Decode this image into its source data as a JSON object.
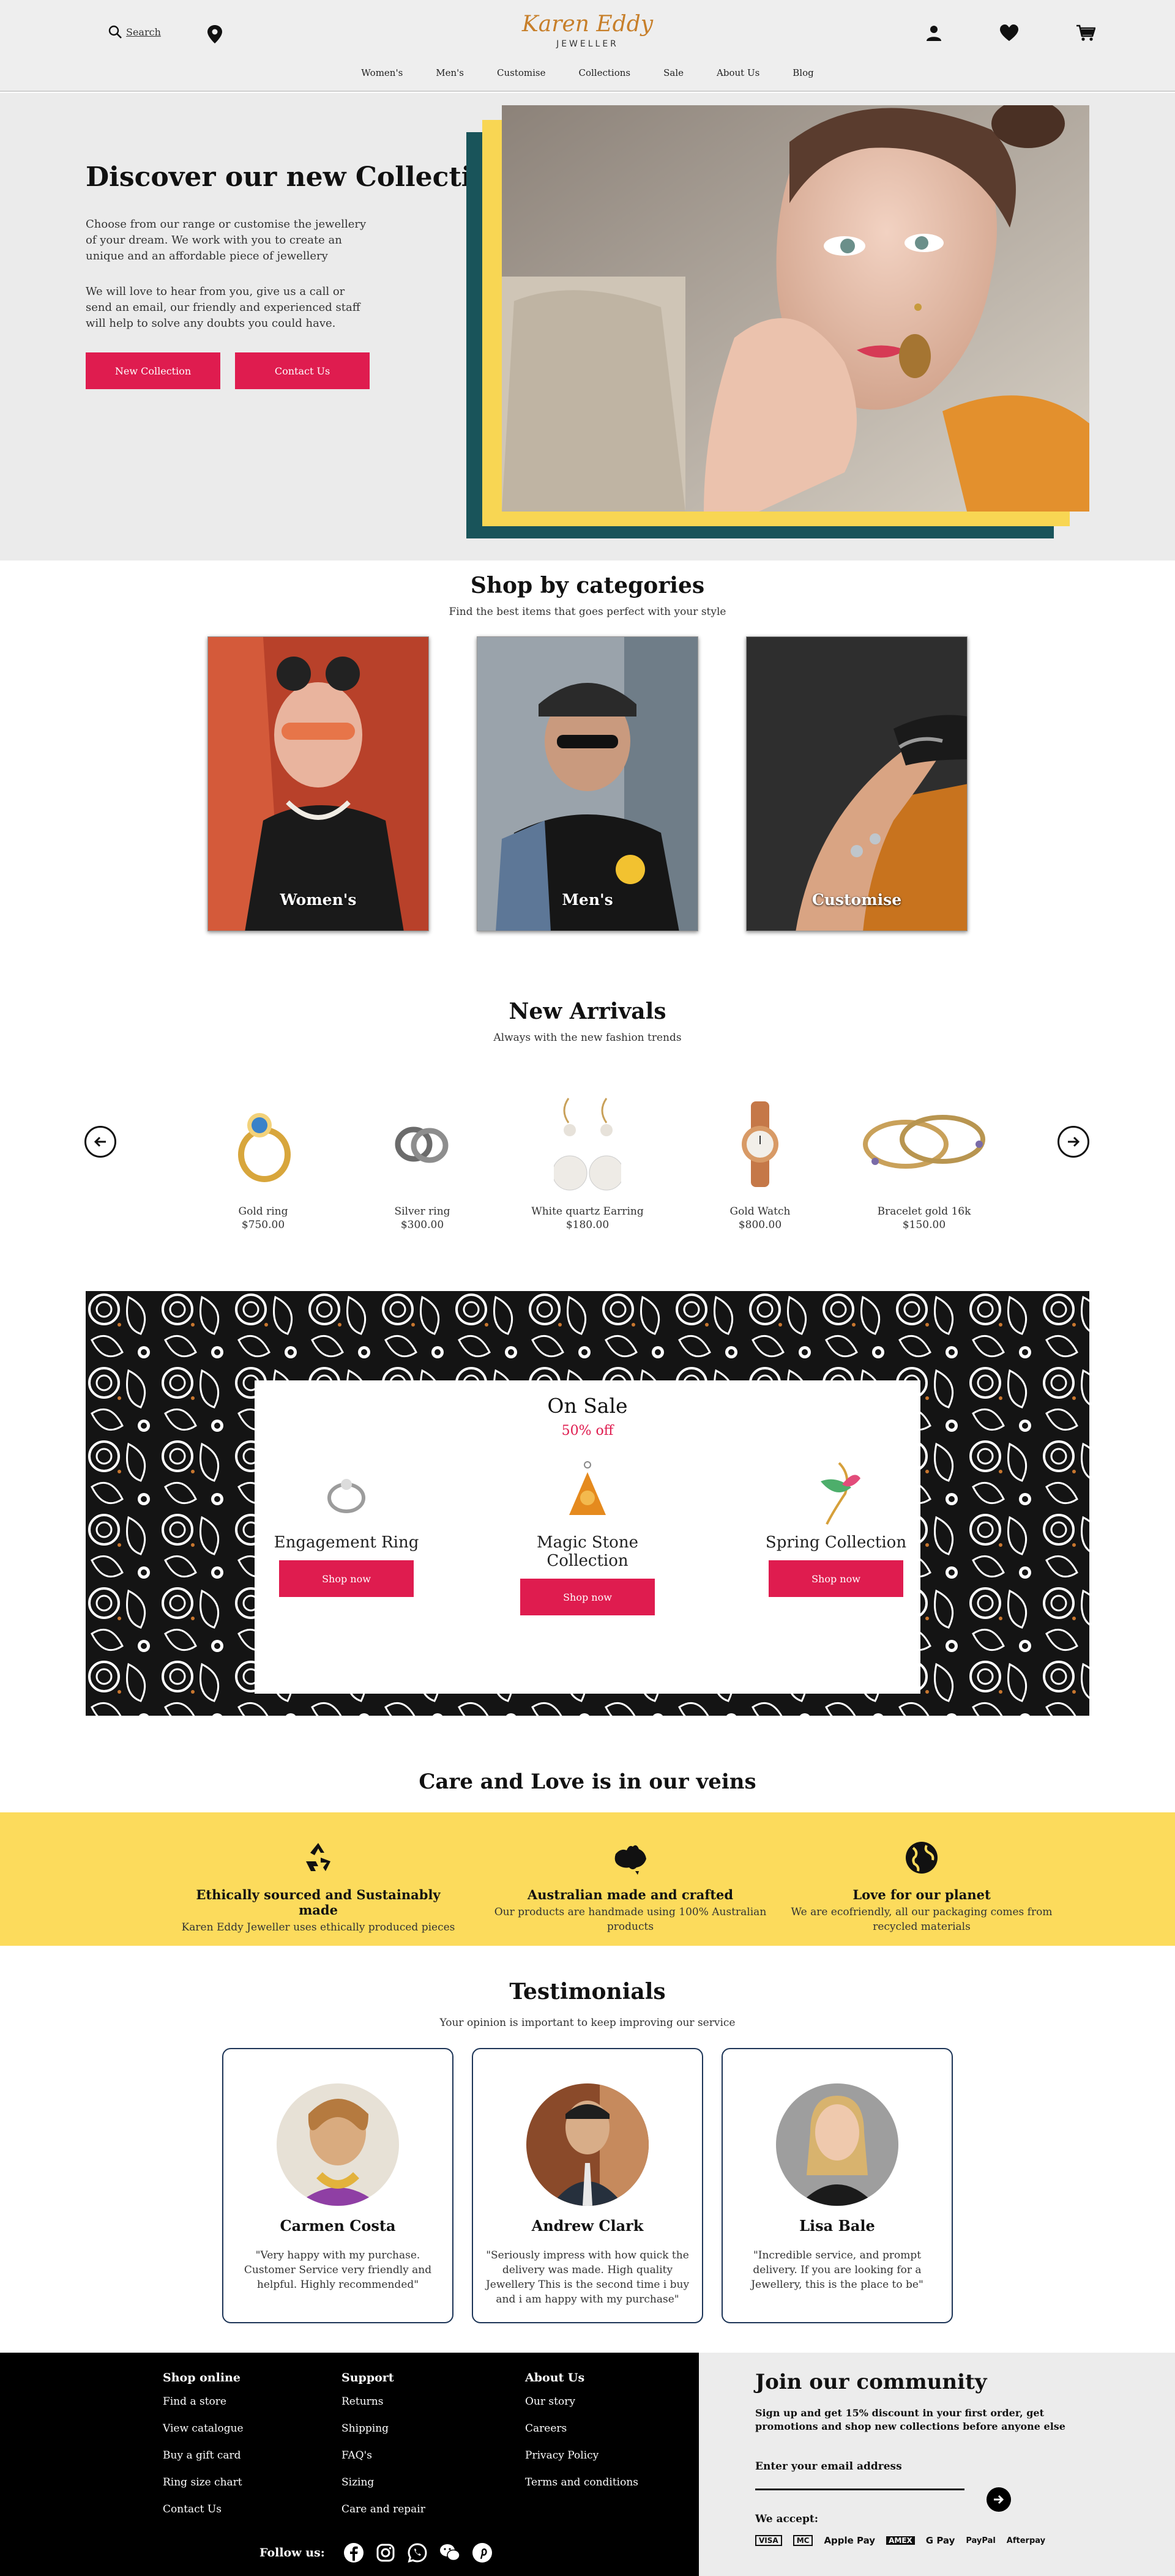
{
  "header": {
    "search_label": "Search",
    "brand": "Karen Eddy",
    "brand_sub": "JEWELLER",
    "nav": [
      "Women's",
      "Men's",
      "Customise",
      "Collections",
      "Sale",
      "About Us",
      "Blog"
    ]
  },
  "hero": {
    "title": "Discover our new Collection",
    "p1": "Choose from our range or customise the jewellery of your dream. We work with you to create an unique and an affordable piece of jewellery",
    "p2": "We will love to hear from you, give us a call or send an email, our friendly and experienced staff will help to solve any doubts you could have.",
    "btn1": "New Collection",
    "btn2": "Contact Us"
  },
  "categories": {
    "title": "Shop by categories",
    "subtitle": "Find the best items that goes perfect with your style",
    "items": [
      {
        "label": "Women's"
      },
      {
        "label": "Men's"
      },
      {
        "label": "Customise"
      }
    ]
  },
  "arrivals": {
    "title": "New Arrivals",
    "subtitle": "Always with the new fashion trends",
    "items": [
      {
        "name": "Gold ring",
        "price": "$750.00"
      },
      {
        "name": "Silver ring",
        "price": "$300.00"
      },
      {
        "name": "White quartz Earring",
        "price": "$180.00"
      },
      {
        "name": "Gold Watch",
        "price": "$800.00"
      },
      {
        "name": "Bracelet gold 16k",
        "price": "$150.00"
      }
    ]
  },
  "sale": {
    "title": "On Sale",
    "discount": "50% off",
    "items": [
      {
        "name": "Engagement Ring",
        "button": "Shop now"
      },
      {
        "name": "Magic Stone Collection",
        "button": "Shop now"
      },
      {
        "name": "Spring Collection",
        "button": "Shop now"
      }
    ]
  },
  "care": {
    "title": "Care and Love is in our veins",
    "items": [
      {
        "title": "Ethically sourced and Sustainably made",
        "desc": "Karen Eddy Jeweller uses ethically produced pieces"
      },
      {
        "title": "Australian made and crafted",
        "desc": "Our products are handmade using 100% Australian products"
      },
      {
        "title": "Love for our planet",
        "desc": "We are ecofriendly, all our packaging comes from recycled materials"
      }
    ]
  },
  "testimonials": {
    "title": "Testimonials",
    "subtitle": "Your opinion is important to keep improving our service",
    "items": [
      {
        "name": "Carmen Costa",
        "quote": "\"Very happy with my purchase. Customer Service very friendly and helpful. Highly recommended\""
      },
      {
        "name": "Andrew Clark",
        "quote": "\"Seriously impress with how quick the delivery was made. High quality Jewellery This is the second time i buy and i am happy with my purchase\""
      },
      {
        "name": "Lisa Bale",
        "quote": "\"Incredible service, and prompt delivery. If you are looking for a Jewellery, this is the place to be\""
      }
    ]
  },
  "footer": {
    "shop": {
      "title": "Shop online",
      "links": [
        "Find a store",
        "View catalogue",
        "Buy a gift card",
        "Ring size chart",
        "Contact Us"
      ]
    },
    "support": {
      "title": "Support",
      "links": [
        "Returns",
        "Shipping",
        "FAQ's",
        "Sizing",
        "Care and repair"
      ]
    },
    "about": {
      "title": "About Us",
      "links": [
        "Our story",
        "Careers",
        "Privacy Policy",
        "Terms and conditions"
      ]
    },
    "follow_label": "Follow us:",
    "social_icons": [
      "facebook-icon",
      "instagram-icon",
      "whatsapp-icon",
      "wechat-icon",
      "pinterest-icon"
    ],
    "join_title": "Join our community",
    "join_desc": "Sign up and get 15% discount in your first order, get promotions and shop new collections before anyone else",
    "email_label": "Enter your email address",
    "accept_label": "We accept:",
    "payments": [
      "VISA",
      "MC",
      "Apple Pay",
      "AMEX",
      "G Pay",
      "PayPal",
      "Afterpay"
    ]
  },
  "colors": {
    "accent_red": "#df1c4f",
    "teal": "#19545a",
    "yellow": "#f8d653",
    "care_band": "#fcdb5c",
    "brand_gold": "#c77f2a"
  }
}
